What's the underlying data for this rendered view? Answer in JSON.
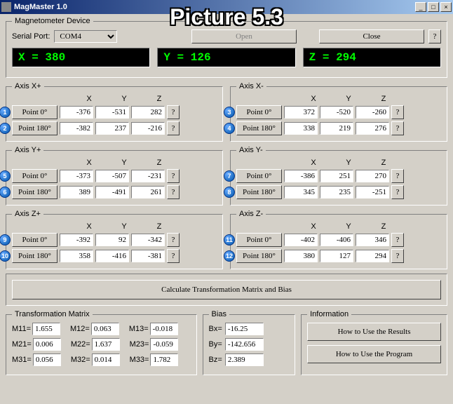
{
  "overlay": "Picture 5.3",
  "window": {
    "title": "MagMaster 1.0"
  },
  "device": {
    "legend": "Magnetometer Device",
    "serial_label": "Serial Port:",
    "serial_value": "COM4",
    "open": "Open",
    "close": "Close",
    "help": "?"
  },
  "lcd": {
    "x": "X = 380",
    "y": "Y = 126",
    "z": "Z = 294"
  },
  "cols": {
    "x": "X",
    "y": "Y",
    "z": "Z"
  },
  "axes": {
    "xp": {
      "legend": "Axis X+",
      "p0": {
        "b": "1",
        "lbl": "Point 0°",
        "x": "-376",
        "y": "-531",
        "z": "282"
      },
      "p180": {
        "b": "2",
        "lbl": "Point 180°",
        "x": "-382",
        "y": "237",
        "z": "-216"
      }
    },
    "xm": {
      "legend": "Axis X-",
      "p0": {
        "b": "3",
        "lbl": "Point 0°",
        "x": "372",
        "y": "-520",
        "z": "-260"
      },
      "p180": {
        "b": "4",
        "lbl": "Point 180°",
        "x": "338",
        "y": "219",
        "z": "276"
      }
    },
    "yp": {
      "legend": "Axis Y+",
      "p0": {
        "b": "5",
        "lbl": "Point 0°",
        "x": "-373",
        "y": "-507",
        "z": "-231"
      },
      "p180": {
        "b": "6",
        "lbl": "Point 180°",
        "x": "389",
        "y": "-491",
        "z": "261"
      }
    },
    "ym": {
      "legend": "Axis Y-",
      "p0": {
        "b": "7",
        "lbl": "Point 0°",
        "x": "-386",
        "y": "251",
        "z": "270"
      },
      "p180": {
        "b": "8",
        "lbl": "Point 180°",
        "x": "345",
        "y": "235",
        "z": "-251"
      }
    },
    "zp": {
      "legend": "Axis Z+",
      "p0": {
        "b": "9",
        "lbl": "Point 0°",
        "x": "-392",
        "y": "92",
        "z": "-342"
      },
      "p180": {
        "b": "10",
        "lbl": "Point 180°",
        "x": "358",
        "y": "-416",
        "z": "-381"
      }
    },
    "zm": {
      "legend": "Axis Z-",
      "p0": {
        "b": "11",
        "lbl": "Point 0°",
        "x": "-402",
        "y": "-406",
        "z": "346"
      },
      "p180": {
        "b": "12",
        "lbl": "Point 180°",
        "x": "380",
        "y": "127",
        "z": "294"
      }
    }
  },
  "calc": "Calculate Transformation Matrix and Bias",
  "matrix": {
    "legend": "Transformation Matrix",
    "m11l": "M11=",
    "m11": "1.655",
    "m12l": "M12=",
    "m12": "0.063",
    "m13l": "M13=",
    "m13": "-0.018",
    "m21l": "M21=",
    "m21": "0.006",
    "m22l": "M22=",
    "m22": "1.637",
    "m23l": "M23=",
    "m23": "-0.059",
    "m31l": "M31=",
    "m31": "0.056",
    "m32l": "M32=",
    "m32": "0.014",
    "m33l": "M33=",
    "m33": "1.782"
  },
  "bias": {
    "legend": "Bias",
    "bxl": "Bx=",
    "bx": "-16.25",
    "byl": "By=",
    "by": "-142.656",
    "bzl": "Bz=",
    "bz": "2.389"
  },
  "info": {
    "legend": "Information",
    "results": "How to Use the Results",
    "program": "How to Use the Program"
  },
  "q": "?"
}
